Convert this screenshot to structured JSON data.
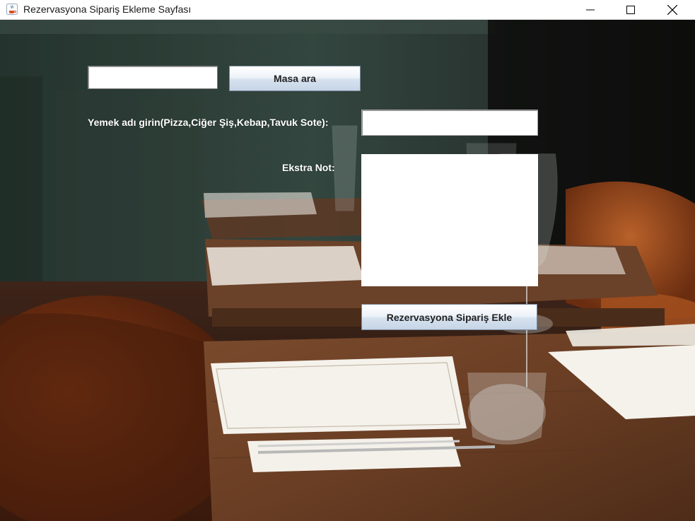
{
  "window": {
    "title": "Rezervasyona Sipariş Ekleme Sayfası",
    "controls": [
      "minimize-icon",
      "maximize-icon",
      "close-icon"
    ]
  },
  "search": {
    "input_value": "",
    "button_label": "Masa ara"
  },
  "food": {
    "label": "Yemek adı girin(Pizza,Ciğer Şiş,Kebap,Tavuk Sote):",
    "input_value": ""
  },
  "note": {
    "label": "Ekstra Not:",
    "value": ""
  },
  "submit": {
    "button_label": "Rezervasyona Sipariş Ekle"
  },
  "colors": {
    "titlebar": "#ffffff",
    "label_text": "#ffffff",
    "button_border": "#7a8a9e"
  }
}
